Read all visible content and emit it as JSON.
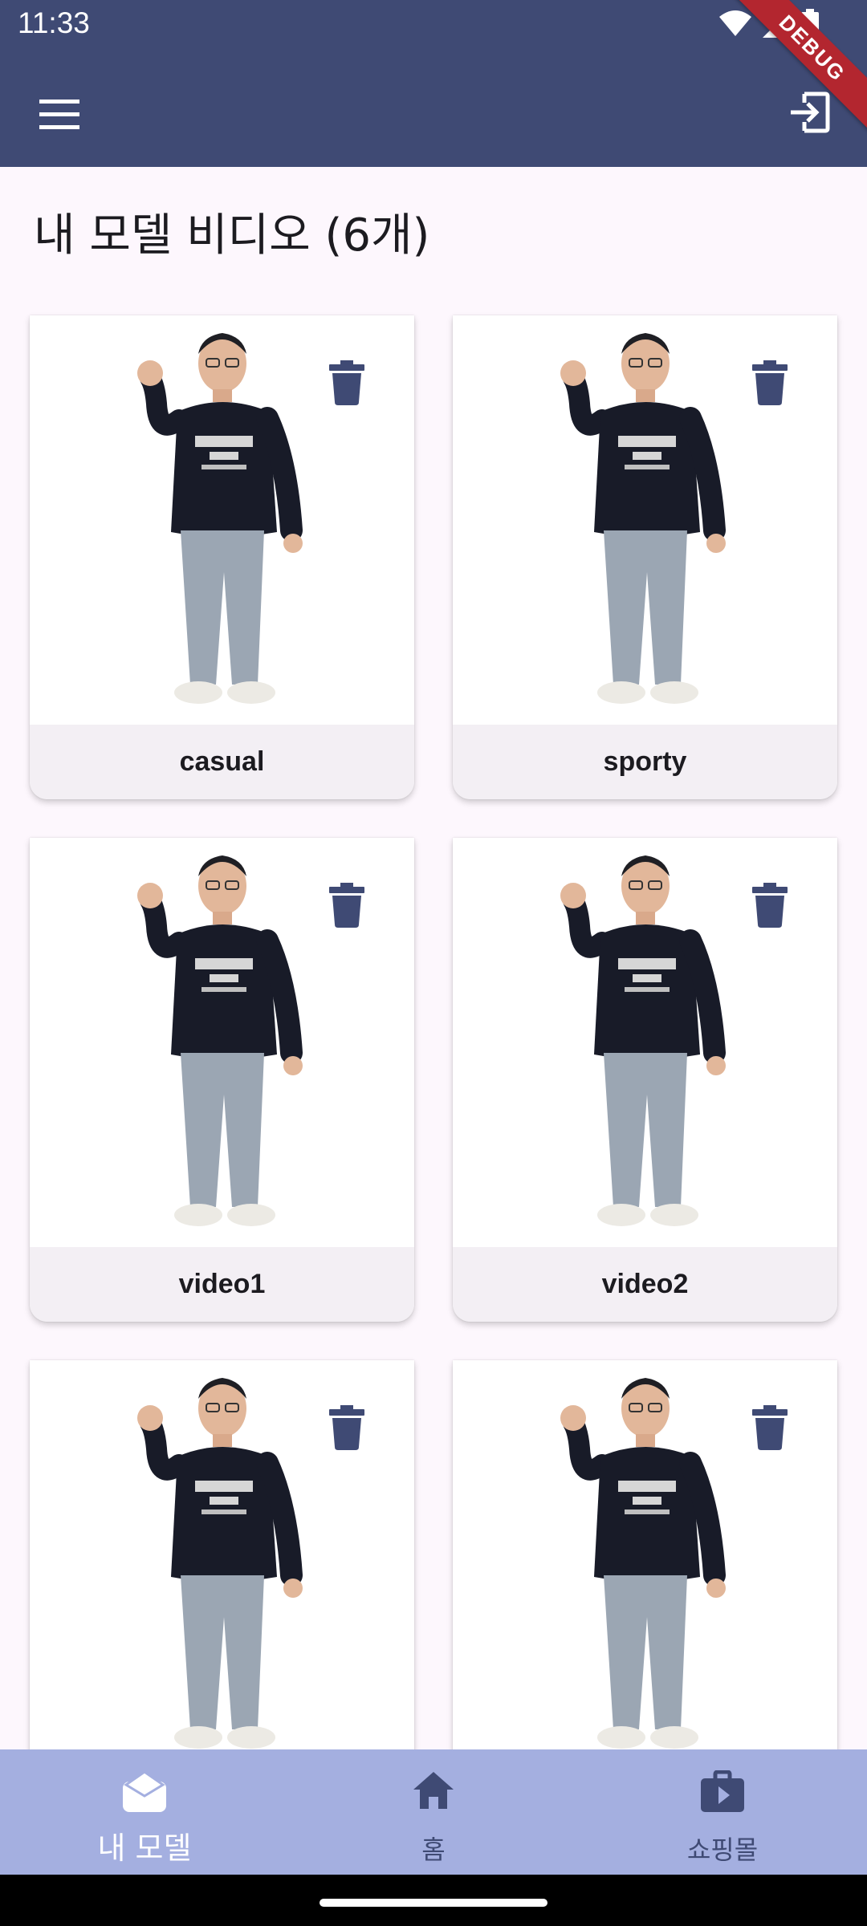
{
  "status_bar": {
    "time": "11:33",
    "debug_label": "DEBUG",
    "icons": [
      "wifi-icon",
      "signal-icon",
      "battery-icon"
    ]
  },
  "app_bar": {
    "menu_icon": "menu-icon",
    "logout_icon": "logout-icon",
    "background": "#3f4a74"
  },
  "page": {
    "title": "내 모델 비디오 (6개)"
  },
  "videos": [
    {
      "label": "casual"
    },
    {
      "label": "sporty"
    },
    {
      "label": "video1"
    },
    {
      "label": "video2"
    },
    {
      "label": ""
    },
    {
      "label": ""
    }
  ],
  "bottom_nav": {
    "items": [
      {
        "label": "내 모델",
        "icon": "model-icon",
        "active": true
      },
      {
        "label": "홈",
        "icon": "home-icon",
        "active": false
      },
      {
        "label": "쇼핑몰",
        "icon": "shopping-bag-icon",
        "active": false
      }
    ],
    "background": "#a4afe0"
  },
  "colors": {
    "accent": "#3f4a74",
    "page_bg": "#fdf7fd"
  }
}
